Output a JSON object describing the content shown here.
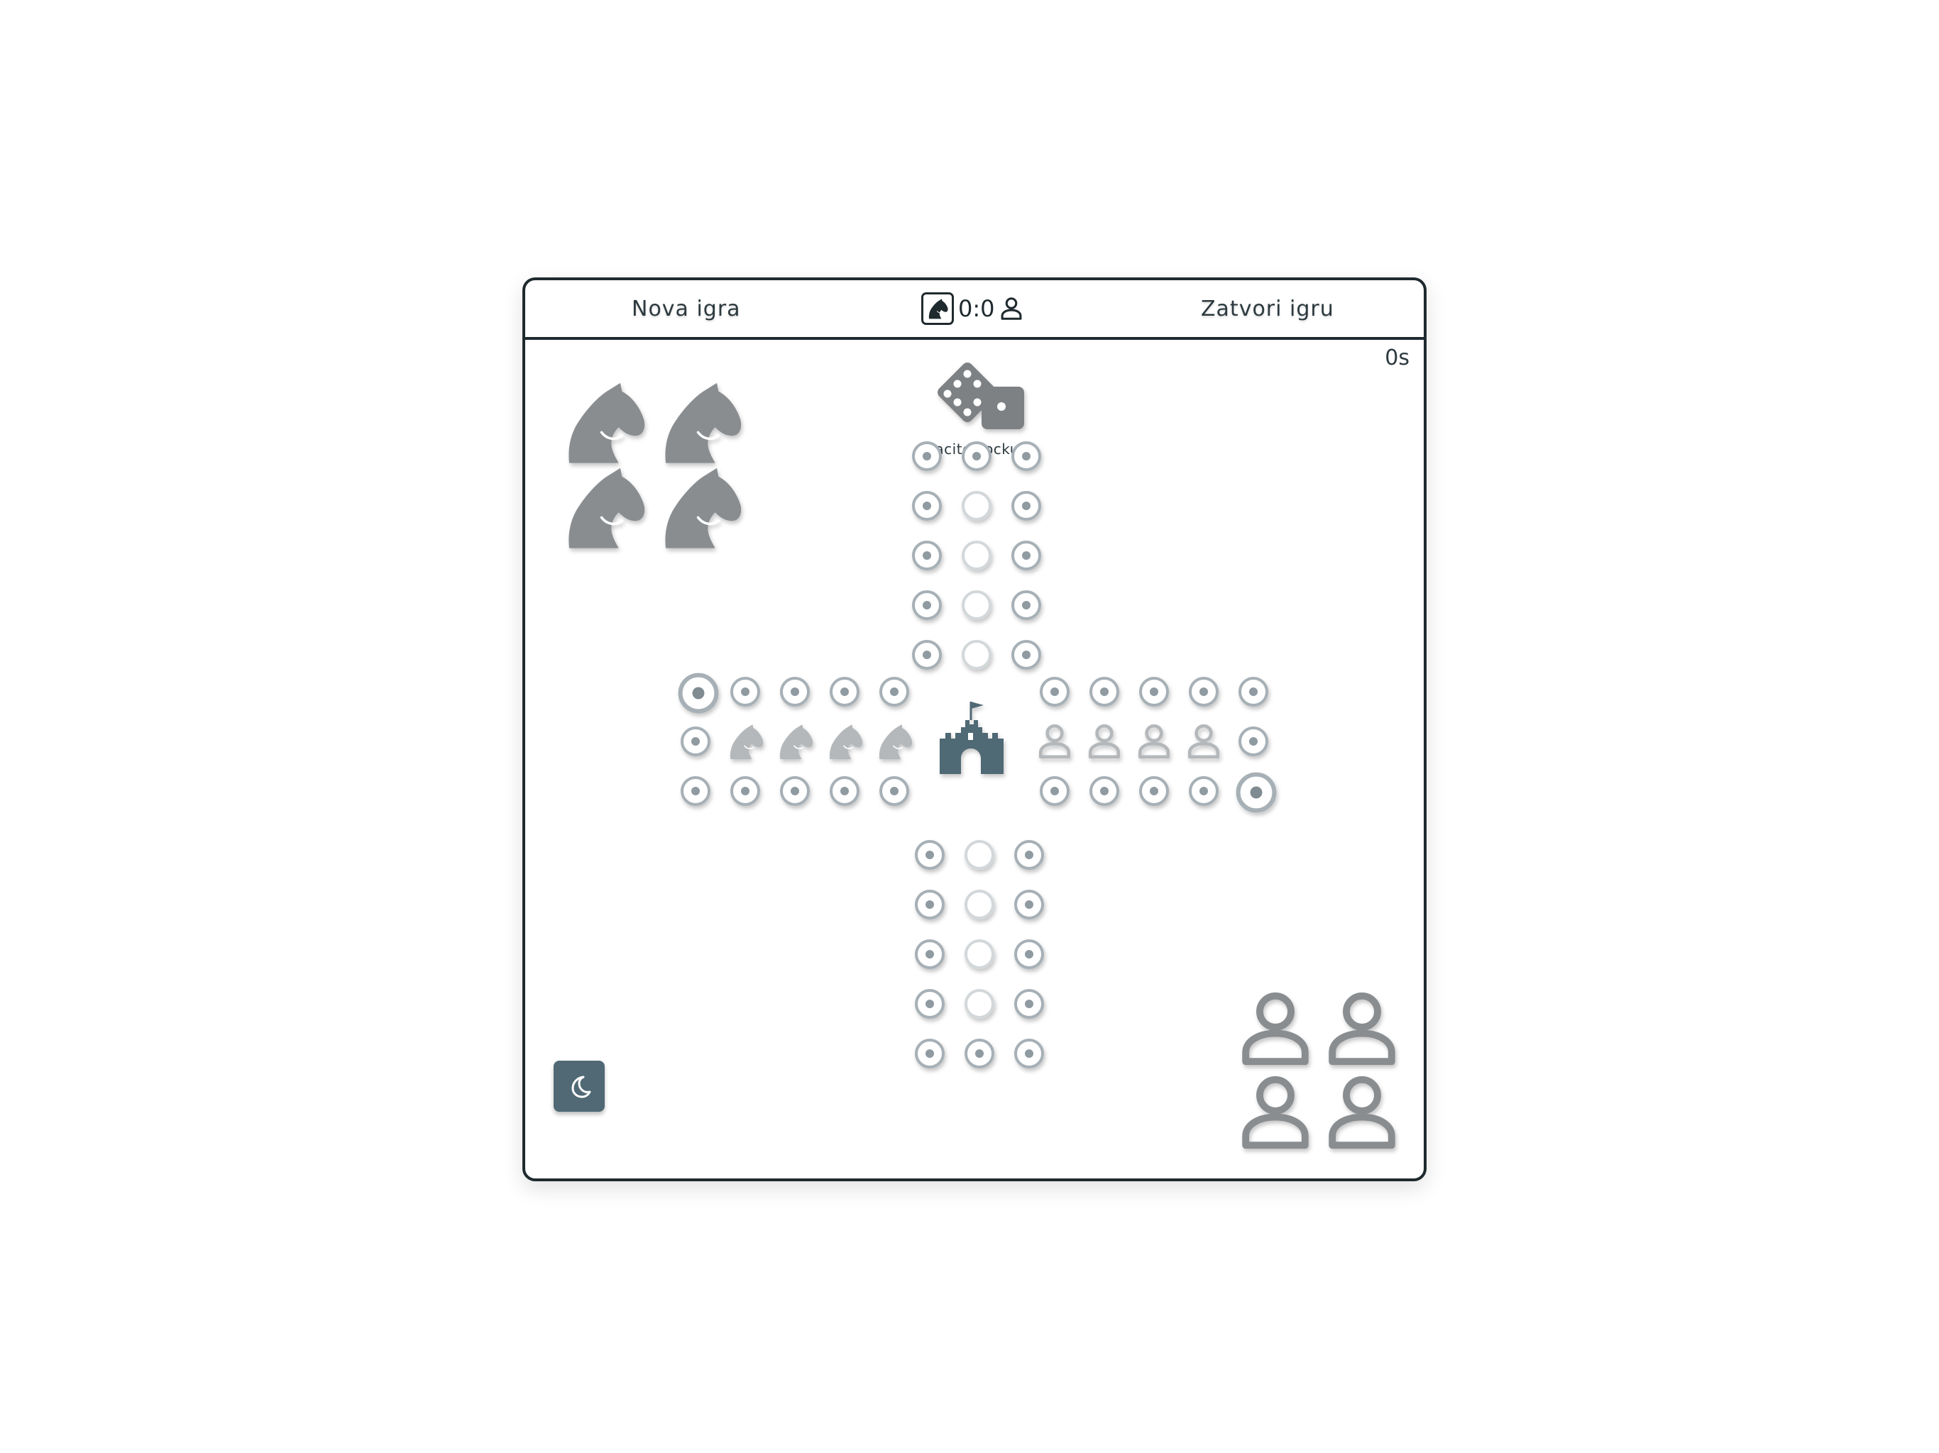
{
  "header": {
    "new_game_label": "Nova igra",
    "close_game_label": "Zatvori igru",
    "score": "0:0"
  },
  "timer": "0s",
  "dice": {
    "status_message": "Bacite kocku."
  },
  "players": {
    "horse": {
      "home_pieces": 4,
      "finish_pieces": 4,
      "color": "#8a8d90"
    },
    "person": {
      "home_pieces": 4,
      "finish_pieces": 4,
      "color": "#8a8d90"
    }
  },
  "colors": {
    "frame_border": "#1f2a2e",
    "accent": "#506975",
    "cell_ring": "#a6b0b6",
    "piece_gray": "#8a8d90"
  },
  "icons": {
    "score_left": "horse-icon",
    "score_right": "person-icon",
    "center": "castle-icon",
    "theme_toggle": "moon-icon"
  }
}
